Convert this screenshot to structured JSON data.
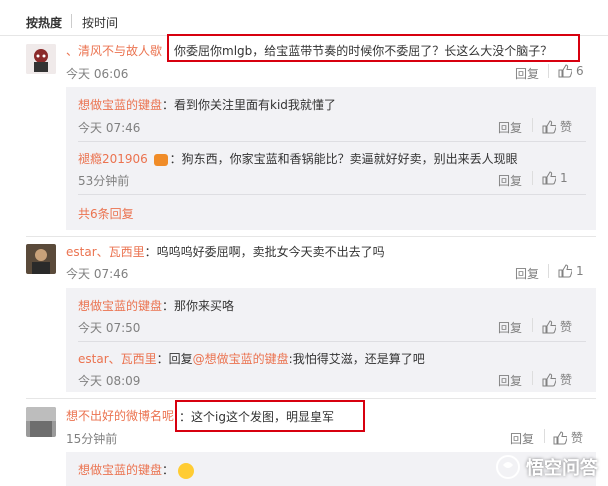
{
  "sort": {
    "hot": "按热度",
    "time": "按时间"
  },
  "colors": {
    "accent": "#eb7350",
    "highlight": "#d7000f"
  },
  "comments": [
    {
      "user": "、清风不与故人歇",
      "text": "你委屈你mlgb，给宝蓝带节奏的时候你不委屈了？长这么大没个脑子？",
      "time": "今天 06:06",
      "reply_label": "回复",
      "likes": "6",
      "replies": [
        {
          "user": "想做宝蓝的键盘",
          "text": "：看到你关注里面有kid我就懂了",
          "time": "今天 07:46",
          "reply_label": "回复",
          "like_label": "赞"
        },
        {
          "user": "褪瘾201906",
          "text": "：狗东西，你家宝蓝和香锅能比？卖逼就好好卖，别出来丢人现眼",
          "time": "53分钟前",
          "reply_label": "回复",
          "likes": "1"
        }
      ],
      "more_replies": "共6条回复"
    },
    {
      "user": "estar、瓦西里",
      "text": "：呜呜呜好委屈啊，卖批女今天卖不出去了吗",
      "time": "今天 07:46",
      "reply_label": "回复",
      "likes": "1",
      "replies": [
        {
          "user": "想做宝蓝的键盘",
          "text": "：那你来买咯",
          "time": "今天 07:50",
          "reply_label": "回复",
          "like_label": "赞"
        },
        {
          "user": "estar、瓦西里",
          "text": "：回复",
          "mention": "@想做宝蓝的键盘",
          "text2": ":我怕得艾滋，还是算了吧",
          "time": "今天 08:09",
          "reply_label": "回复",
          "like_label": "赞"
        }
      ]
    },
    {
      "user": "想不出好的微博名呢",
      "text": "：这个ig这个发图，明显皇军",
      "time": "15分钟前",
      "reply_label": "回复",
      "like_label": "赞",
      "replies": [
        {
          "user": "想做宝蓝的键盘",
          "text": "："
        }
      ]
    }
  ],
  "watermark": "悟空问答"
}
